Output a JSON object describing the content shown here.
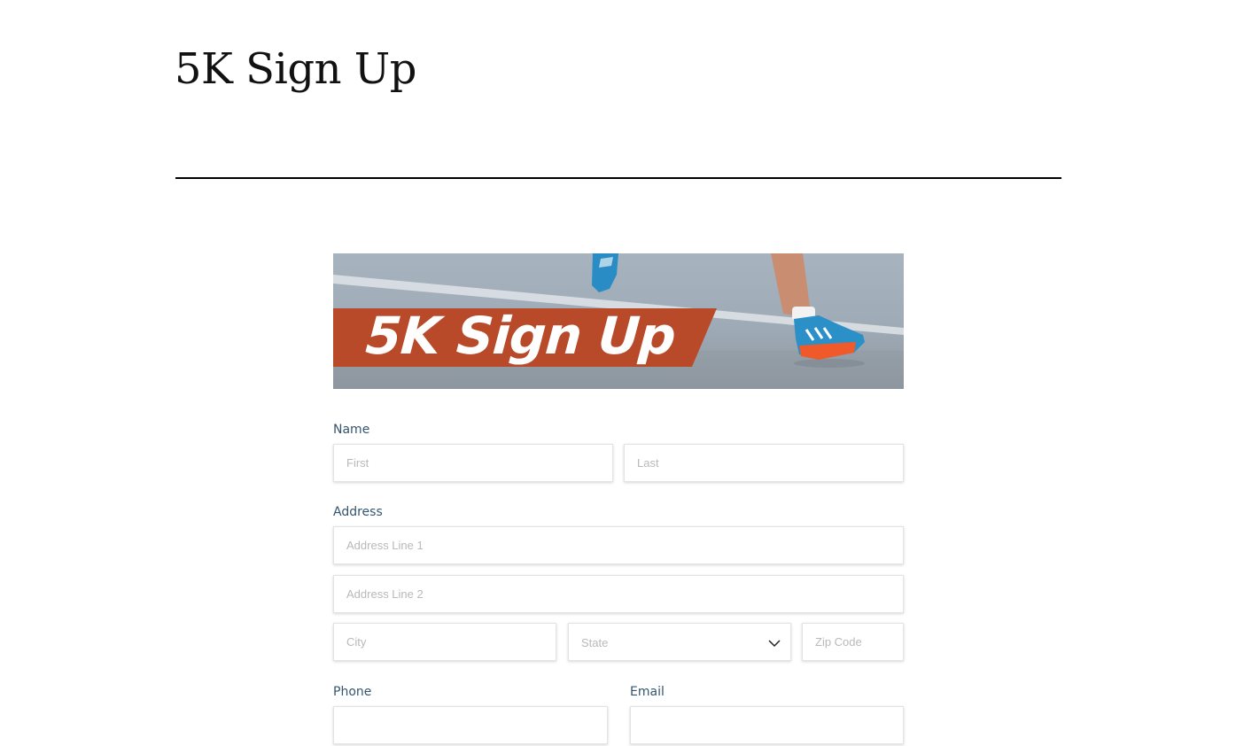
{
  "page": {
    "title": "5K Sign Up"
  },
  "banner": {
    "text": "5K Sign Up",
    "stripe_color": "#b84a2a"
  },
  "form": {
    "name": {
      "label": "Name",
      "first_placeholder": "First",
      "last_placeholder": "Last"
    },
    "address": {
      "label": "Address",
      "line1_placeholder": "Address Line 1",
      "line2_placeholder": "Address Line 2",
      "city_placeholder": "City",
      "state_value": "State",
      "zip_placeholder": "Zip Code"
    },
    "phone": {
      "label": "Phone",
      "placeholder": ""
    },
    "email": {
      "label": "Email",
      "placeholder": ""
    }
  },
  "icons": {
    "state_dropdown": "chevron-down-icon"
  },
  "colors": {
    "label": "#34556f",
    "placeholder": "#b9b9b9",
    "divider": "#000000"
  }
}
